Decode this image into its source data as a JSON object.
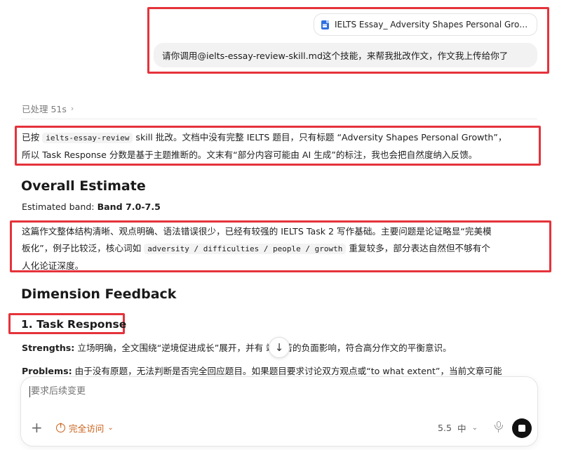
{
  "user_message": {
    "attachment_name": "IELTS Essay_ Adversity Shapes Personal Growt…",
    "text": "请你调用@ielts-essay-review-skill.md这个技能，来帮我批改作文，作文我上传给你了"
  },
  "processed": {
    "label": "已处理 51s",
    "chevron": "›"
  },
  "intro": {
    "p1": "已按 ",
    "code": "ielts-essay-review",
    "p2": " skill 批改。文档中没有完整 IELTS 题目，只有标题 “Adversity Shapes Personal Growth”，",
    "line2": "所以 Task Response 分数是基于主题推断的。文末有“部分内容可能由 AI 生成”的标注，我也会把自然度纳入反馈。"
  },
  "overall": {
    "heading": "Overall Estimate",
    "band_label": "Estimated band: ",
    "band_value": "Band 7.0-7.5",
    "summary_l1": "这篇作文整体结构清晰、观点明确、语法错误很少，已经有较强的 IELTS Task 2 写作基础。主要问题是论证略显“完美模",
    "summary_l2a": "板化”，例子比较泛，核心词如 ",
    "summary_code": "adversity / difficulties / people / growth",
    "summary_l2b": " 重复较多，部分表达自然但不够有个",
    "summary_l3": "人化论证深度。"
  },
  "dimension": {
    "heading": "Dimension Feedback",
    "sub1": "1. Task Response",
    "strengths_label": "Strengths:",
    "strengths_text": " 立场明确，全文围绕“逆境促进成长”展开，并有  端痛苦的负面影响，符合高分作文的平衡意识。",
    "problems_label": "Problems:",
    "problems_text": " 由于没有原题，无法判断是否完全回应题目。如果题目要求讨论双方观点或“to what extent”，当前文章可能"
  },
  "scroll_icon": "↓",
  "composer": {
    "placeholder": "要求后续变更",
    "plus": "+",
    "access_label": "完全访问",
    "chevron": "⌄",
    "model_version": "5.5",
    "model_level": "中"
  },
  "colors": {
    "highlight": "#e5333b",
    "access": "#c9601a"
  }
}
